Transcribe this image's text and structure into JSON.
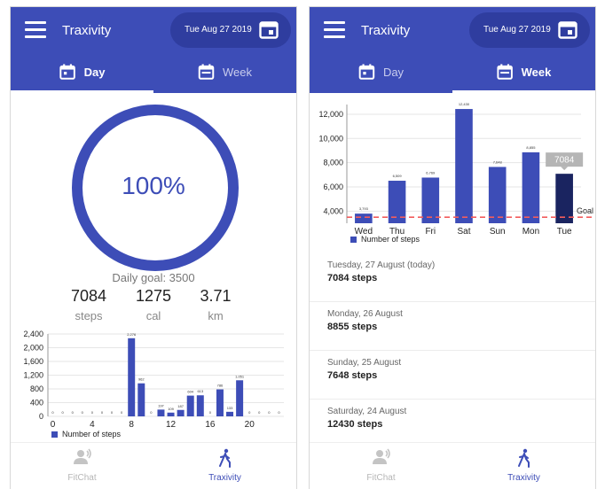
{
  "colors": {
    "primary": "#3d4db7",
    "primary_dark": "#2f3d9f",
    "selected_bar": "#1a2460",
    "goal_line": "#f25c5c",
    "tooltip_bg": "#b5b5b5"
  },
  "left": {
    "app_title": "Traxivity",
    "date": "Tue Aug 27 2019",
    "tabs": [
      {
        "label": "Day",
        "icon": "calendar-day-icon"
      },
      {
        "label": "Week",
        "icon": "calendar-week-icon"
      }
    ],
    "progress_percent": "100%",
    "progress_fraction": 1.0,
    "daily_goal": "Daily goal: 3500",
    "stats": [
      {
        "value": "7084",
        "unit": "steps"
      },
      {
        "value": "1275",
        "unit": "cal"
      },
      {
        "value": "3.71",
        "unit": "km"
      }
    ],
    "legend": "Number of steps",
    "bottom_nav": [
      {
        "label": "FitChat",
        "icon": "chat-person-icon"
      },
      {
        "label": "Traxivity",
        "icon": "walking-person-icon"
      }
    ]
  },
  "right": {
    "app_title": "Traxivity",
    "date": "Tue Aug 27 2019",
    "tabs": [
      {
        "label": "Day",
        "icon": "calendar-day-icon"
      },
      {
        "label": "Week",
        "icon": "calendar-week-icon"
      }
    ],
    "legend": "Number of steps",
    "tooltip": "7084",
    "goal_label": "Goal",
    "list": [
      {
        "date": "Tuesday, 27 August (today)",
        "steps": "7084 steps"
      },
      {
        "date": "Monday, 26 August",
        "steps": "8855 steps"
      },
      {
        "date": "Sunday, 25 August",
        "steps": "7648 steps"
      },
      {
        "date": "Saturday, 24 August",
        "steps": "12430 steps"
      }
    ],
    "bottom_nav": [
      {
        "label": "FitChat",
        "icon": "chat-person-icon"
      },
      {
        "label": "Traxivity",
        "icon": "walking-person-icon"
      }
    ]
  },
  "chart_data": [
    {
      "type": "bar",
      "series": [
        {
          "name": "Number of steps",
          "x": [
            0,
            1,
            2,
            3,
            4,
            5,
            6,
            7,
            8,
            9,
            10,
            11,
            12,
            13,
            14,
            15,
            16,
            17,
            18,
            19,
            20,
            21,
            22,
            23
          ],
          "values": [
            0,
            0,
            0,
            0,
            0,
            0,
            0,
            0,
            2276,
            962,
            0,
            197,
            109,
            187,
            604,
            613,
            0,
            786,
            133,
            1051,
            0,
            0,
            0,
            0
          ]
        }
      ],
      "value_labels": [
        "0",
        "0",
        "0",
        "0",
        "0",
        "0",
        "0",
        "0",
        "2,276",
        "962",
        "0",
        "197",
        "109",
        "187",
        "604",
        "613",
        "0",
        "786",
        "133",
        "1,051",
        "0",
        "0",
        "0",
        "0"
      ],
      "xticks": [
        "0",
        "4",
        "8",
        "12",
        "16",
        "20"
      ],
      "yticks": [
        "0",
        "400",
        "800",
        "1,200",
        "1,600",
        "2,000",
        "2,400"
      ],
      "ylim": [
        0,
        2400
      ]
    },
    {
      "type": "bar",
      "categories": [
        "Wed",
        "Thu",
        "Fri",
        "Sat",
        "Sun",
        "Mon",
        "Tue"
      ],
      "series": [
        {
          "name": "Number of steps",
          "values": [
            3793,
            6509,
            6769,
            12430,
            7648,
            8855,
            7084
          ]
        }
      ],
      "value_labels": [
        "3,793",
        "6,509",
        "6,769",
        "12,430",
        "7,648",
        "8,855",
        ""
      ],
      "yticks": [
        "4,000",
        "6,000",
        "8,000",
        "10,000",
        "12,000"
      ],
      "ylim": [
        3000,
        12800
      ],
      "goal": 3500,
      "selected_index": 6
    }
  ]
}
